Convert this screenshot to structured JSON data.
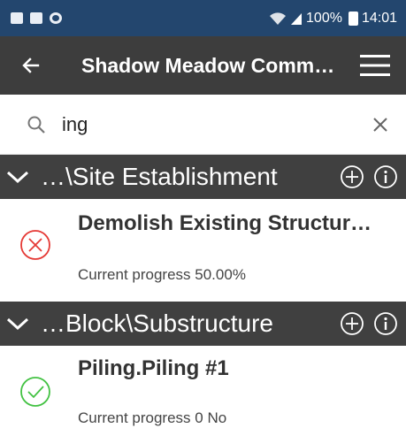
{
  "status_bar": {
    "left_icons": [
      "notification-icon",
      "image-icon",
      "sync-icon"
    ],
    "battery": "100%",
    "time": "14:01"
  },
  "app_bar": {
    "title": "Shadow Meadow Comm…"
  },
  "search": {
    "value": "ing"
  },
  "groups": [
    {
      "title": "…\\Site Establishment",
      "tasks": [
        {
          "title": "Demolish Existing Structur…",
          "progress": "Current progress 50.00%",
          "status": "error"
        }
      ]
    },
    {
      "title": "…Block\\Substructure",
      "tasks": [
        {
          "title": "Piling.Piling #1",
          "progress": "Current progress 0 No",
          "status": "ok"
        }
      ]
    }
  ],
  "colors": {
    "status_bar": "#23466e",
    "app_bar": "#3d3d3d",
    "group_header": "#404040",
    "error": "#e53935",
    "ok": "#43c243"
  }
}
